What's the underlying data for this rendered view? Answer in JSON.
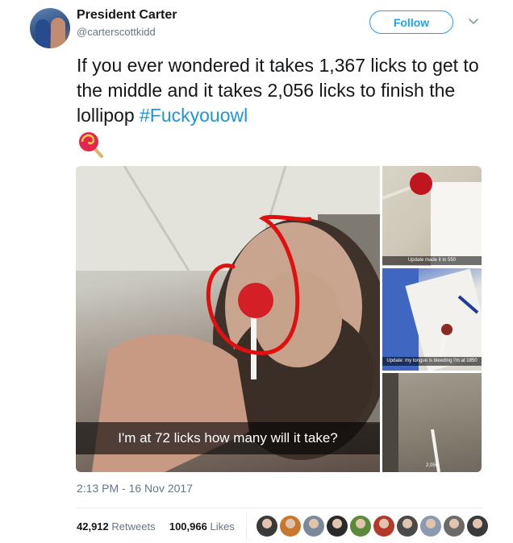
{
  "user": {
    "name": "President Carter",
    "handle": "@carterscottkidd",
    "avatar_icon": "profile-photo"
  },
  "follow_label": "Follow",
  "menu_icon": "chevron-down-icon",
  "tweet": {
    "text_before": "If you ever wondered it takes 1,367 licks to get to the middle and it takes 2,056 licks to finish the lollipop ",
    "hashtag": "#Fuckyouowl",
    "emoji_icon": "lollipop-emoji"
  },
  "media": {
    "main_caption": "I'm at 72 licks how many will it take?",
    "thumb1_caption": "Update made it to 550",
    "thumb2_caption": "Update: my tongue is bleeding I'm at 1850",
    "thumb3_caption": "2,056"
  },
  "timestamp": "2:13 PM - 16 Nov 2017",
  "stats": {
    "retweets_count": "42,912",
    "retweets_label": "Retweets",
    "likes_count": "100,966",
    "likes_label": "Likes"
  },
  "likers": [
    "#3a3a3a",
    "#c9772e",
    "#7a8a9a",
    "#2a2a2a",
    "#5a8a3a",
    "#b33a2a",
    "#4a4a4a",
    "#8a9ab0",
    "#6a6a6a",
    "#3a3a3a"
  ],
  "colors": {
    "accent": "#1da1f2",
    "hashtag": "#1b95e0",
    "annotation_red": "#e01010"
  }
}
